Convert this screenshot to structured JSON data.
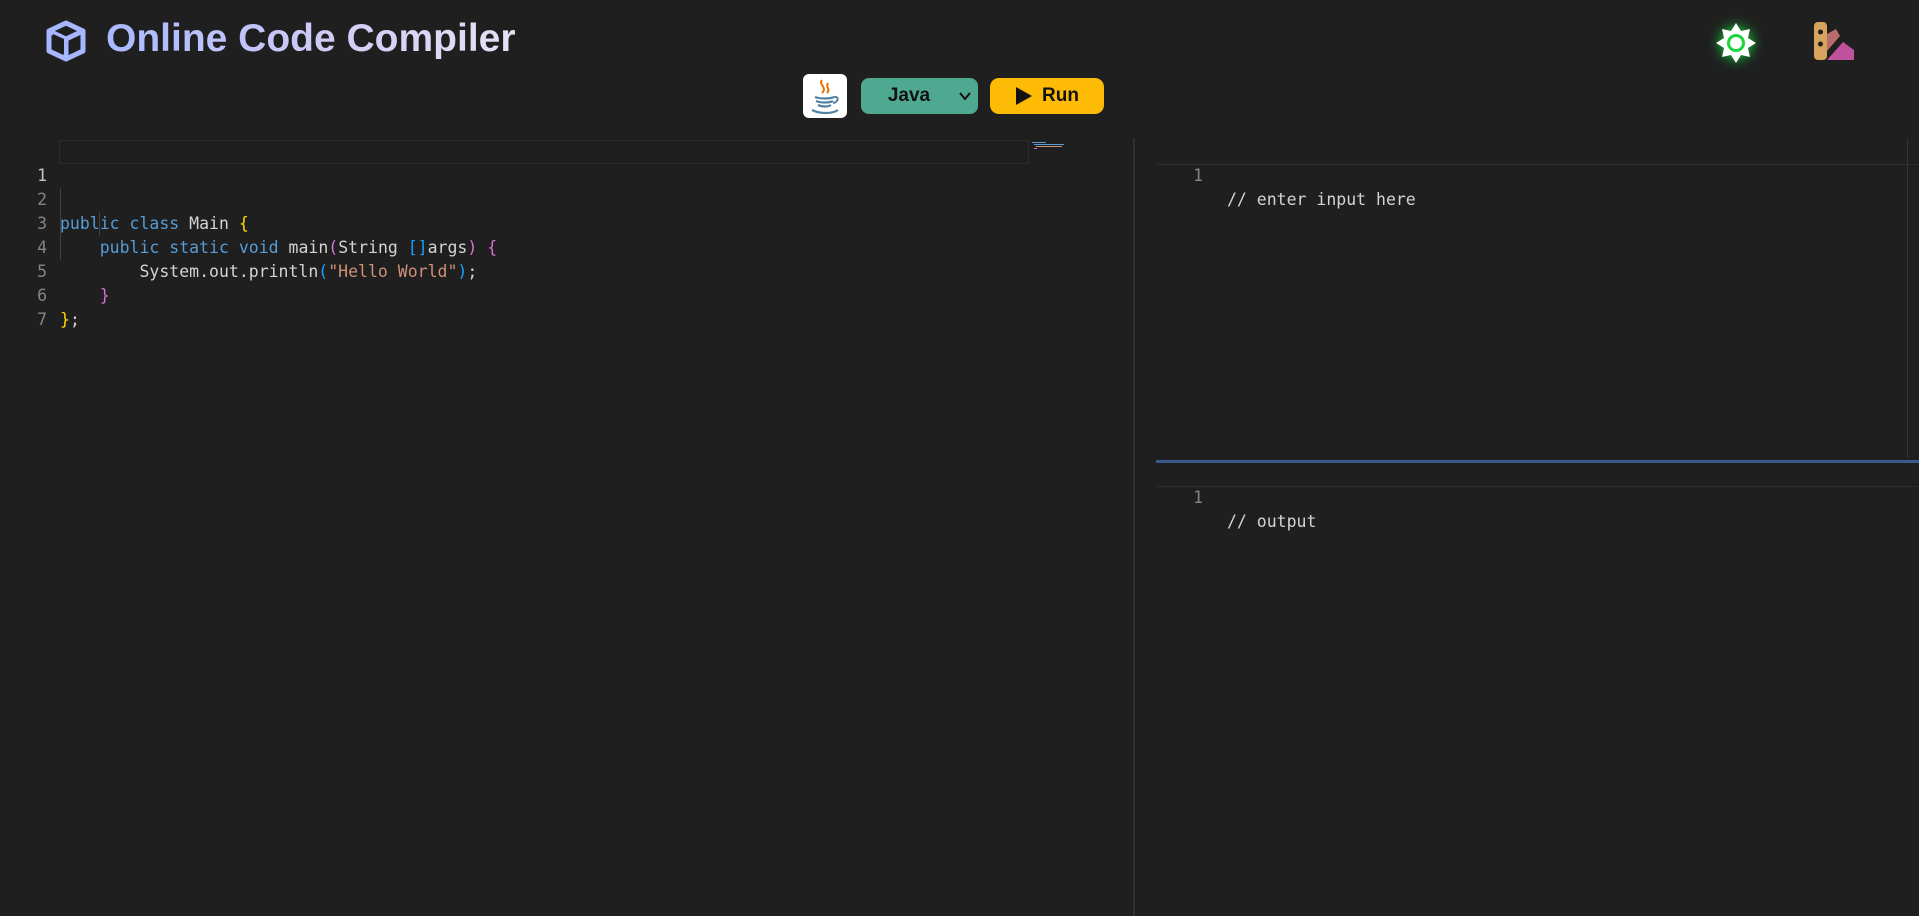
{
  "app": {
    "title": "Online Code Compiler",
    "logo_icon": "cube-icon",
    "theme_icon": "sun-icon",
    "palette_icon": "color-swatch-icon"
  },
  "toolbar": {
    "language_logo": "java-coffee-icon",
    "language_selected": "Java",
    "run_label": "Run",
    "run_icon": "play-icon"
  },
  "code_editor": {
    "lines": [
      {
        "n": "1",
        "active": true
      },
      {
        "n": "2"
      },
      {
        "n": "3"
      },
      {
        "n": "4"
      },
      {
        "n": "5"
      },
      {
        "n": "6"
      },
      {
        "n": "7"
      }
    ],
    "tokens": {
      "l2_public": "public",
      "l2_class": "class",
      "l2_name": " Main ",
      "l2_brace": "{",
      "l3_public": "public",
      "l3_static": "static",
      "l3_void": "void",
      "l3_main": " main",
      "l3_paren_open": "(",
      "l3_string": "String ",
      "l3_brackets": "[]",
      "l3_args": "args",
      "l3_paren_close": ")",
      "l3_brace": " {",
      "l4_call": "System.out.println",
      "l4_paren_open": "(",
      "l4_str": "\"Hello World\"",
      "l4_paren_close": ")",
      "l4_semi": ";",
      "l5_brace": "}",
      "l6_brace": "}",
      "l6_semi": ";"
    }
  },
  "input_editor": {
    "line_number": "1",
    "text": "// enter input here"
  },
  "output_editor": {
    "line_number": "1",
    "text": "// output"
  },
  "colors": {
    "background": "#1f1f1f",
    "language_select": "#4fa890",
    "run_button": "#fdbb05",
    "splitter": "#3b5a8c"
  }
}
